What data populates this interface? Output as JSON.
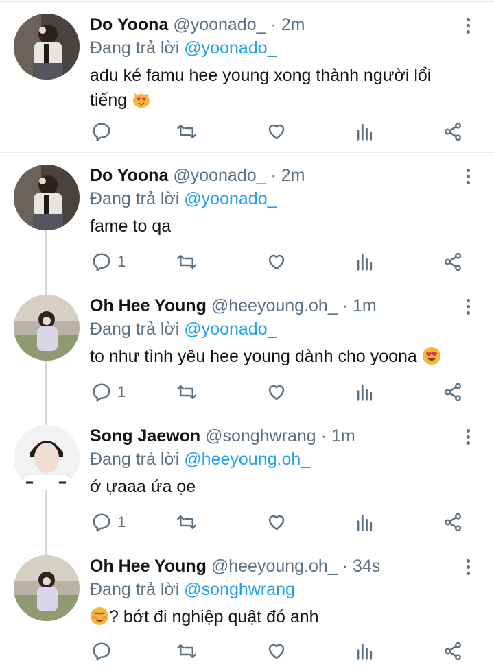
{
  "tweets": [
    {
      "name": "Do Yoona",
      "handle": "@yoonado_",
      "time": "2m",
      "reply_prefix": "Đang trả lời",
      "reply_to": "@yoonado_",
      "text": "adu ké famu hee young xong thành người lổi tiếng",
      "emoji": "smiling-cat-heart-eyes",
      "reply_count": ""
    },
    {
      "name": "Do Yoona",
      "handle": "@yoonado_",
      "time": "2m",
      "reply_prefix": "Đang trả lời",
      "reply_to": "@yoonado_",
      "text": "fame to qa",
      "reply_count": "1"
    },
    {
      "name": "Oh Hee Young",
      "handle": "@heeyoung.oh_",
      "time": "1m",
      "reply_prefix": "Đang trả lời",
      "reply_to": "@yoonado_",
      "text": "to như tình yêu hee young dành cho yoona",
      "emoji": "heart-eyes-face",
      "reply_count": "1"
    },
    {
      "name": "Song Jaewon",
      "handle": "@songhwrang",
      "time": "1m",
      "reply_prefix": "Đang trả lời",
      "reply_to": "@heeyoung.oh_",
      "text": "ớ ựaaa ứa ọe",
      "reply_count": "1"
    },
    {
      "name": "Oh Hee Young",
      "handle": "@heeyoung.oh_",
      "time": "34s",
      "reply_prefix": "Đang trả lời",
      "reply_to": "@songhwrang",
      "text": "? bớt đi nghiệp quật đó anh",
      "emoji": "smiling-blush-face",
      "reply_count": ""
    }
  ],
  "separator": "·",
  "icons": [
    "reply-icon",
    "retweet-icon",
    "like-icon",
    "analytics-icon",
    "share-icon",
    "more-icon"
  ],
  "colors": {
    "link": "#1da1f2",
    "muted": "#5b7083",
    "text": "#0f1419"
  }
}
